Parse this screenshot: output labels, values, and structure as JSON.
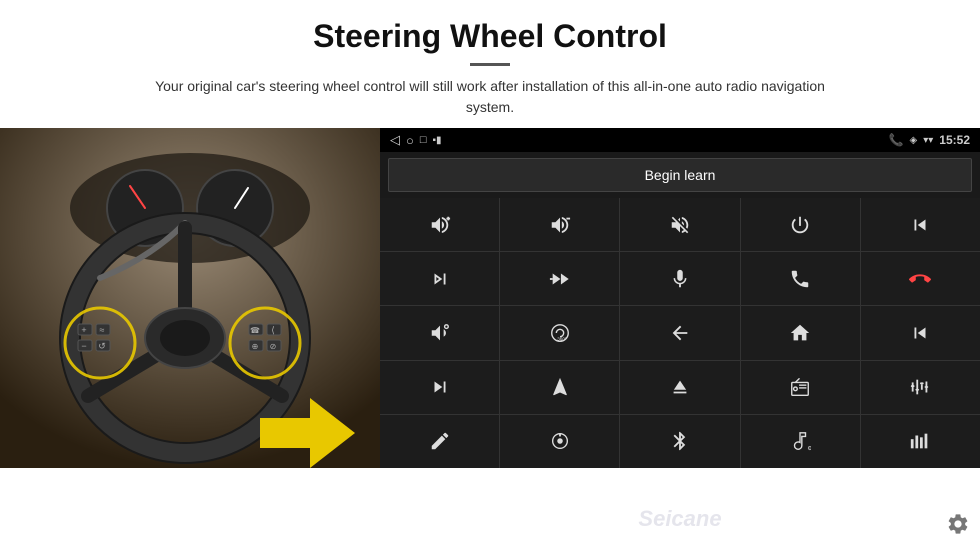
{
  "header": {
    "title": "Steering Wheel Control",
    "subtitle": "Your original car's steering wheel control will still work after installation of this all-in-one auto radio navigation system."
  },
  "android": {
    "status_bar": {
      "back_icon": "◁",
      "circle_icon": "○",
      "square_icon": "□",
      "battery_icon": "▪▪",
      "phone_icon": "📞",
      "location_icon": "◈",
      "wifi_icon": "▾",
      "time": "15:52"
    },
    "begin_learn_label": "Begin learn",
    "seicane_watermark": "Seicane",
    "controls": [
      {
        "icon": "vol_up",
        "unicode": ""
      },
      {
        "icon": "vol_down",
        "unicode": ""
      },
      {
        "icon": "mute",
        "unicode": ""
      },
      {
        "icon": "power",
        "unicode": ""
      },
      {
        "icon": "prev_track",
        "unicode": ""
      },
      {
        "icon": "next",
        "unicode": ""
      },
      {
        "icon": "ff",
        "unicode": ""
      },
      {
        "icon": "mic",
        "unicode": ""
      },
      {
        "icon": "phone",
        "unicode": ""
      },
      {
        "icon": "hang_up",
        "unicode": ""
      },
      {
        "icon": "horn",
        "unicode": ""
      },
      {
        "icon": "360",
        "unicode": ""
      },
      {
        "icon": "back",
        "unicode": ""
      },
      {
        "icon": "home",
        "unicode": ""
      },
      {
        "icon": "skip_back",
        "unicode": ""
      },
      {
        "icon": "fast_fwd",
        "unicode": ""
      },
      {
        "icon": "navigate",
        "unicode": ""
      },
      {
        "icon": "eject",
        "unicode": ""
      },
      {
        "icon": "radio",
        "unicode": ""
      },
      {
        "icon": "equalizer",
        "unicode": ""
      },
      {
        "icon": "edit",
        "unicode": ""
      },
      {
        "icon": "settings_knob",
        "unicode": ""
      },
      {
        "icon": "bluetooth",
        "unicode": ""
      },
      {
        "icon": "music",
        "unicode": ""
      },
      {
        "icon": "bars",
        "unicode": ""
      }
    ]
  }
}
